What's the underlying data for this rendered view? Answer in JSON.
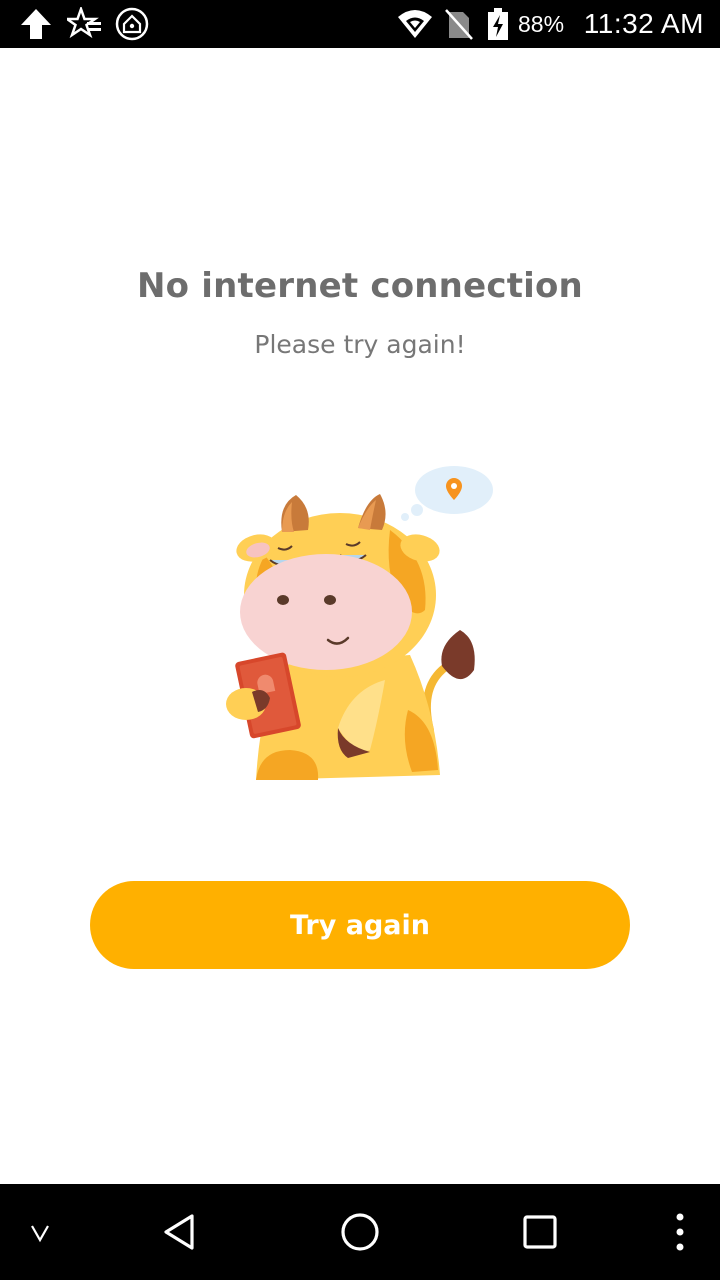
{
  "status_bar": {
    "battery_percent": "88%",
    "time": "11:32 AM",
    "icons": [
      "upload-arrow-icon",
      "star-notification-icon",
      "home-circle-icon",
      "wifi-icon",
      "no-sim-icon",
      "battery-charging-icon"
    ]
  },
  "main": {
    "title": "No internet connection",
    "subtitle": "Please try again!",
    "illustration": "cow-with-phone-illustration",
    "button_label": "Try again"
  },
  "nav_bar": {
    "icons": [
      "chevron-down-icon",
      "back-icon",
      "home-icon",
      "recents-icon",
      "more-vert-icon"
    ]
  },
  "colors": {
    "accent": "#ffb000",
    "title": "#6d6d6d",
    "subtitle": "#777777",
    "bars": "#000000"
  }
}
